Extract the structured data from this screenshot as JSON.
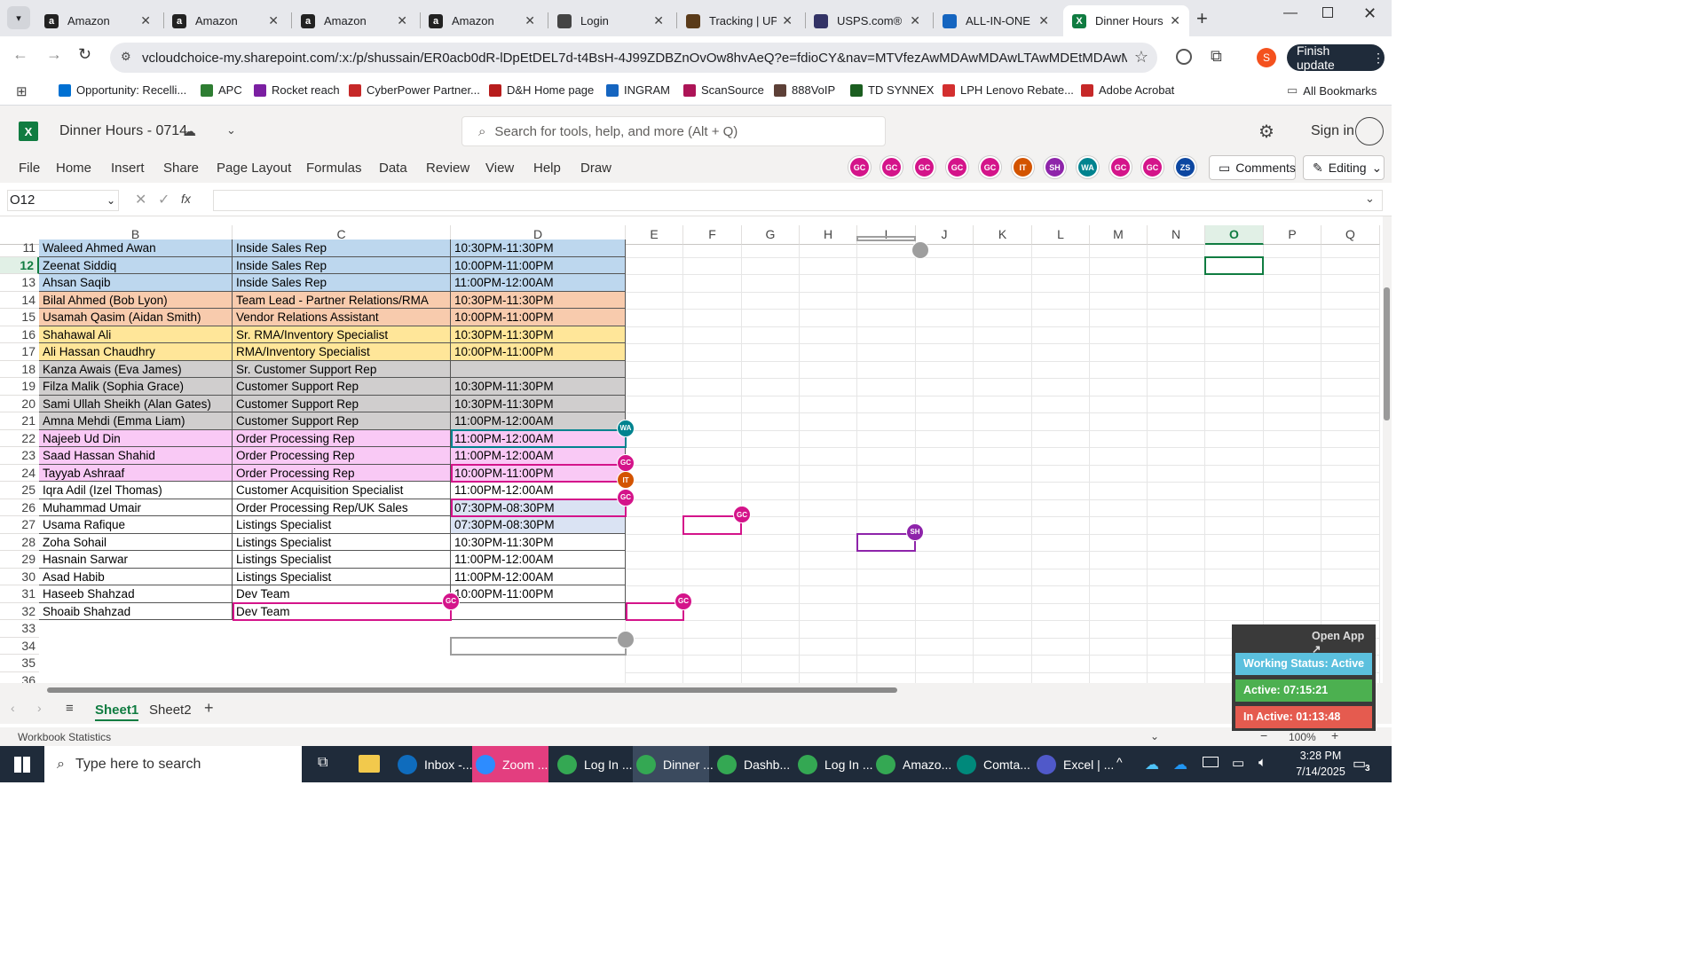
{
  "browser": {
    "tabs": [
      {
        "title": "Amazon",
        "icon": "amazon-icon"
      },
      {
        "title": "Amazon",
        "icon": "amazon-icon"
      },
      {
        "title": "Amazon",
        "icon": "amazon-icon"
      },
      {
        "title": "Amazon",
        "icon": "amazon-icon"
      },
      {
        "title": "Login",
        "icon": "login-icon"
      },
      {
        "title": "Tracking | UP",
        "icon": "ups-icon"
      },
      {
        "title": "USPS.com®",
        "icon": "usps-icon"
      },
      {
        "title": "ALL-IN-ONE",
        "icon": "allinone-icon"
      },
      {
        "title": "Dinner Hours",
        "icon": "excel-icon"
      }
    ],
    "url": "vcloudchoice-my.sharepoint.com/:x:/p/shussain/ER0acb0dR-lDpEtDEL7d-t4BsH-4J99ZDBZnOvOw8hvAeQ?e=fdioCY&nav=MTVfezAwMDAwMDAwLTAwMDEtMDAwMC0wM...",
    "profile_initial": "S",
    "finish_update": "Finish update",
    "bookmarks": [
      {
        "label": "Opportunity: Recelli...",
        "color": "#0070d2"
      },
      {
        "label": "APC",
        "color": "#2e7d32"
      },
      {
        "label": "Rocket reach",
        "color": "#7b1fa2"
      },
      {
        "label": "CyberPower Partner...",
        "color": "#c62828"
      },
      {
        "label": "D&H Home page",
        "color": "#b71c1c"
      },
      {
        "label": "INGRAM",
        "color": "#1565c0"
      },
      {
        "label": "ScanSource",
        "color": "#ad1457"
      },
      {
        "label": "888VoIP",
        "color": "#5d4037"
      },
      {
        "label": "TD SYNNEX",
        "color": "#1b5e20"
      },
      {
        "label": "LPH Lenovo Rebate...",
        "color": "#d32f2f"
      },
      {
        "label": "Adobe Acrobat",
        "color": "#c62828"
      }
    ],
    "all_bookmarks": "All Bookmarks"
  },
  "excel": {
    "title": "Dinner Hours - 0714",
    "search_placeholder": "Search for tools, help, and more (Alt + Q)",
    "sign_in": "Sign in",
    "menu": [
      "File",
      "Home",
      "Insert",
      "Share",
      "Page Layout",
      "Formulas",
      "Data",
      "Review",
      "View",
      "Help",
      "Draw"
    ],
    "collaborators": [
      {
        "initials": "GC",
        "color": "#d4148a"
      },
      {
        "initials": "GC",
        "color": "#d4148a"
      },
      {
        "initials": "GC",
        "color": "#d4148a"
      },
      {
        "initials": "GC",
        "color": "#d4148a"
      },
      {
        "initials": "GC",
        "color": "#d4148a"
      },
      {
        "initials": "IT",
        "color": "#d35400"
      },
      {
        "initials": "SH",
        "color": "#8e24aa"
      },
      {
        "initials": "WA",
        "color": "#00838f"
      },
      {
        "initials": "GC",
        "color": "#d4148a"
      },
      {
        "initials": "GC",
        "color": "#d4148a"
      },
      {
        "initials": "ZS",
        "color": "#0d47a1"
      }
    ],
    "comments": "Comments",
    "editing": "Editing",
    "name_box": "O12",
    "fx": "fx",
    "columns": [
      "B",
      "C",
      "D",
      "E",
      "F",
      "G",
      "H",
      "I",
      "J",
      "K",
      "L",
      "M",
      "N",
      "O",
      "P",
      "Q"
    ],
    "rows": [
      {
        "num": "11",
        "name": "Waleed Ahmed Awan",
        "role": "Inside Sales Rep",
        "hours": "10:30PM-11:30PM",
        "color": "#bdd7ee"
      },
      {
        "num": "12",
        "name": "Zeenat Siddiq",
        "role": "Inside Sales Rep",
        "hours": "10:00PM-11:00PM",
        "color": "#bdd7ee"
      },
      {
        "num": "13",
        "name": "Ahsan Saqib",
        "role": "Inside Sales Rep",
        "hours": "11:00PM-12:00AM",
        "color": "#bdd7ee"
      },
      {
        "num": "14",
        "name": "Bilal Ahmed (Bob Lyon)",
        "role": "Team Lead - Partner Relations/RMA",
        "hours": "10:30PM-11:30PM",
        "color": "#f8cbad"
      },
      {
        "num": "15",
        "name": "Usamah Qasim (Aidan Smith)",
        "role": "Vendor Relations Assistant",
        "hours": "10:00PM-11:00PM",
        "color": "#f8cbad"
      },
      {
        "num": "16",
        "name": "Shahawal Ali",
        "role": "Sr. RMA/Inventory Specialist",
        "hours": "10:30PM-11:30PM",
        "color": "#ffe699"
      },
      {
        "num": "17",
        "name": "Ali Hassan Chaudhry",
        "role": "RMA/Inventory Specialist",
        "hours": "10:00PM-11:00PM",
        "color": "#ffe699"
      },
      {
        "num": "18",
        "name": "Kanza Awais (Eva James)",
        "role": "Sr. Customer Support Rep",
        "hours": "",
        "color": "#d0cece"
      },
      {
        "num": "19",
        "name": "Filza Malik (Sophia Grace)",
        "role": "Customer Support Rep",
        "hours": "10:30PM-11:30PM",
        "color": "#d0cece"
      },
      {
        "num": "20",
        "name": "Sami Ullah Sheikh (Alan Gates)",
        "role": "Customer Support Rep",
        "hours": "10:30PM-11:30PM",
        "color": "#d0cece"
      },
      {
        "num": "21",
        "name": "Amna Mehdi (Emma Liam)",
        "role": "Customer Support Rep",
        "hours": "11:00PM-12:00AM",
        "color": "#d0cece"
      },
      {
        "num": "22",
        "name": "Najeeb Ud Din",
        "role": "Order Processing Rep",
        "hours": "11:00PM-12:00AM",
        "color": "#f9c9f5"
      },
      {
        "num": "23",
        "name": "Saad Hassan Shahid",
        "role": "Order Processing Rep",
        "hours": "11:00PM-12:00AM",
        "color": "#f9c9f5"
      },
      {
        "num": "24",
        "name": "Tayyab Ashraaf",
        "role": "Order Processing Rep",
        "hours": "10:00PM-11:00PM",
        "color": "#f9c9f5"
      },
      {
        "num": "25",
        "name": "Iqra Adil (Izel Thomas)",
        "role": "Customer Acquisition Specialist",
        "hours": "11:00PM-12:00AM",
        "color": "#ffffff"
      },
      {
        "num": "26",
        "name": "Muhammad Umair",
        "role": "Order Processing Rep/UK Sales",
        "hours": "07:30PM-08:30PM",
        "color": "#ffffff",
        "hours_color": "#dae3f3"
      },
      {
        "num": "27",
        "name": "Usama Rafique",
        "role": "Listings Specialist",
        "hours": "07:30PM-08:30PM",
        "color": "#ffffff",
        "hours_color": "#dae3f3"
      },
      {
        "num": "28",
        "name": "Zoha Sohail",
        "role": "Listings Specialist",
        "hours": "10:30PM-11:30PM",
        "color": "#ffffff"
      },
      {
        "num": "29",
        "name": "Hasnain Sarwar",
        "role": "Listings Specialist",
        "hours": "11:00PM-12:00AM",
        "color": "#ffffff"
      },
      {
        "num": "30",
        "name": "Asad Habib",
        "role": "Listings Specialist",
        "hours": "11:00PM-12:00AM",
        "color": "#ffffff"
      },
      {
        "num": "31",
        "name": "Haseeb Shahzad",
        "role": "Dev Team",
        "hours": "10:00PM-11:00PM",
        "color": "#ffffff"
      },
      {
        "num": "32",
        "name": "Shoaib Shahzad",
        "role": "Dev Team",
        "hours": "",
        "color": "#ffffff"
      }
    ],
    "empty_rows": [
      "33",
      "34",
      "35",
      "36"
    ],
    "sheets": [
      "Sheet1",
      "Sheet2"
    ],
    "status_left": "Workbook Statistics",
    "zoom": "100%"
  },
  "widget": {
    "open_app": "Open App ↗",
    "working_status": "Working Status: Active",
    "active": "Active: 07:15:21",
    "inactive": "In Active: 01:13:48"
  },
  "taskbar": {
    "search_placeholder": "Type here to search",
    "apps": [
      {
        "label": "Inbox -...",
        "color": "#0f6cbd"
      },
      {
        "label": "Zoom ...",
        "color": "#2d8cff"
      },
      {
        "label": "Log In ...",
        "color": "#34a853"
      },
      {
        "label": "Dinner ...",
        "color": "#34a853"
      },
      {
        "label": "Dashb...",
        "color": "#34a853"
      },
      {
        "label": "Log In ...",
        "color": "#34a853"
      },
      {
        "label": "Amazo...",
        "color": "#34a853"
      },
      {
        "label": "Comta...",
        "color": "#00897b"
      },
      {
        "label": "Excel | ...",
        "color": "#5059c9"
      }
    ],
    "time": "3:28 PM",
    "date": "7/14/2025",
    "notifications": "3"
  }
}
